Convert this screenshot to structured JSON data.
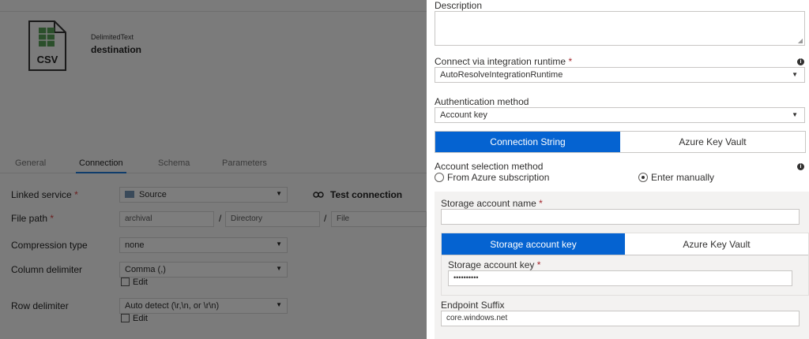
{
  "dataset": {
    "type": "DelimitedText",
    "name": "destination",
    "icon": "csv-file-icon",
    "icon_text": "CSV"
  },
  "tabs": [
    {
      "label": "General",
      "active": false
    },
    {
      "label": "Connection",
      "active": true
    },
    {
      "label": "Schema",
      "active": false
    },
    {
      "label": "Parameters",
      "active": false
    }
  ],
  "connection": {
    "linked_service_label": "Linked service",
    "linked_service_value": "Source",
    "test_connection": "Test connection",
    "file_path_label": "File path",
    "file_path": {
      "container": "archival",
      "directory_placeholder": "Directory",
      "file_placeholder": "File",
      "separator": "/"
    },
    "compression_label": "Compression type",
    "compression_value": "none",
    "column_delim_label": "Column delimiter",
    "column_delim_value": "Comma (,)",
    "edit_label": "Edit",
    "row_delim_label": "Row delimiter",
    "row_delim_value": "Auto detect (\\r,\\n, or \\r\\n)",
    "required_mark": "*"
  },
  "panel": {
    "description_label": "Description",
    "runtime_label": "Connect via integration runtime",
    "runtime_value": "AutoResolveIntegrationRuntime",
    "auth_label": "Authentication method",
    "auth_value": "Account key",
    "conn_tabs": {
      "primary": "Connection String",
      "secondary": "Azure Key Vault",
      "selected": "Connection String"
    },
    "account_sel_label": "Account selection method",
    "radio_from_azure": "From Azure subscription",
    "radio_manual": "Enter manually",
    "radio_selected": "Enter manually",
    "storage_name_label": "Storage account name",
    "storage_name_value": "",
    "key_tabs": {
      "primary": "Storage account key",
      "secondary": "Azure Key Vault",
      "selected": "Storage account key"
    },
    "storage_key_label": "Storage account key",
    "storage_key_value": "••••••••••",
    "endpoint_label": "Endpoint Suffix",
    "endpoint_value": "core.windows.net",
    "required_mark": "*",
    "info_glyph": "i"
  },
  "colors": {
    "accent": "#0563d1",
    "required": "#a4262c",
    "overlay": "#7b7b7b"
  }
}
